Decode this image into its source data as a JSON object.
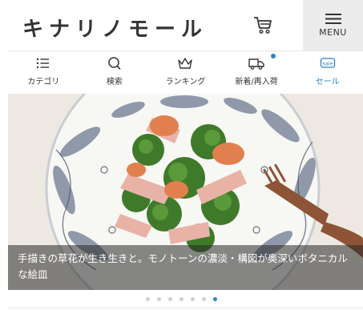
{
  "header": {
    "logo": "キナリノモール",
    "menu_label": "MENU"
  },
  "icons": {
    "cart": "cart-icon",
    "menu": "hamburger-icon"
  },
  "nav": {
    "items": [
      {
        "label": "カテゴリ",
        "icon": "list-icon"
      },
      {
        "label": "検索",
        "icon": "search-icon"
      },
      {
        "label": "ランキング",
        "icon": "crown-icon"
      },
      {
        "label": "新着/再入荷",
        "icon": "truck-icon"
      },
      {
        "label": "セール",
        "icon": "sale-icon",
        "badge": "sale"
      }
    ],
    "accent": "#2a84c6"
  },
  "hero": {
    "caption": "手描きの草花が生き生きと。モノトーンの濃淡・構図が奥深いボタニカルな絵皿"
  },
  "carousel": {
    "count": 7,
    "active_index": 6
  }
}
